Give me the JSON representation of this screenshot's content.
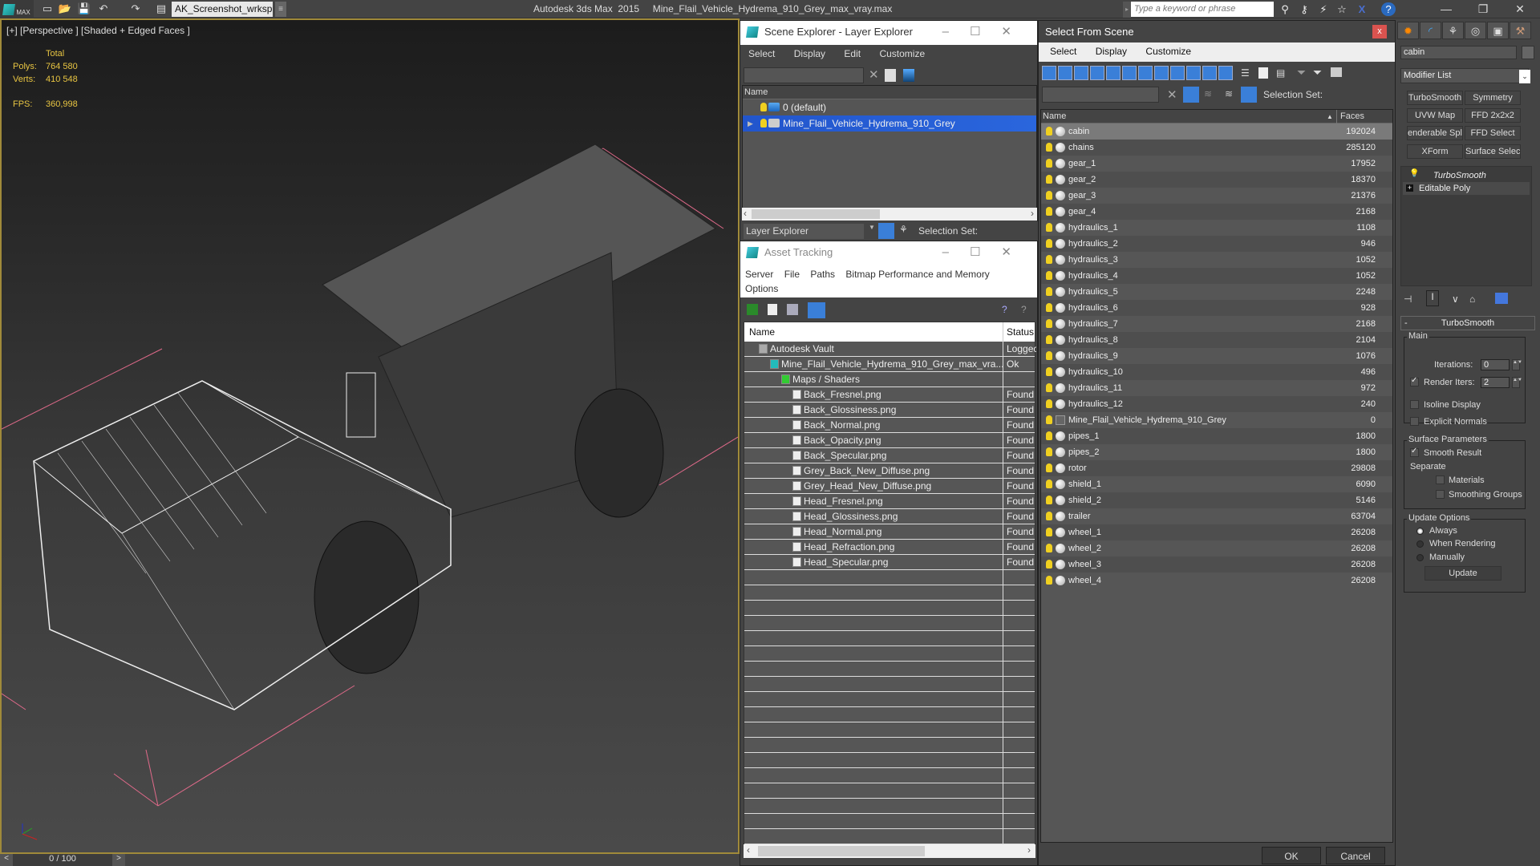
{
  "titlebar": {
    "workspace": "AK_Screenshot_wrksp",
    "app_title": "Autodesk 3ds Max  2015     Mine_Flail_Vehicle_Hydrema_910_Grey_max_vray.max",
    "search_placeholder": "Type a keyword or phrase",
    "logo_label": "MAX"
  },
  "viewport": {
    "label": "[+] [Perspective ] [Shaded + Edged Faces ]",
    "stats": {
      "header": "Total",
      "polys_label": "Polys:",
      "polys": "764 580",
      "verts_label": "Verts:",
      "verts": "410 548",
      "fps_label": "FPS:",
      "fps": "360,998"
    },
    "axis": {
      "x": "x",
      "y": "y",
      "z": "z"
    }
  },
  "timeline": {
    "range": "0 / 100",
    "prev": "<",
    "next": ">"
  },
  "scene_explorer": {
    "title": "Scene Explorer - Layer Explorer",
    "menu": [
      "Select",
      "Display",
      "Edit",
      "Customize"
    ],
    "column": "Name",
    "layers": [
      {
        "name": "0 (default)",
        "selected": false
      },
      {
        "name": "Mine_Flail_Vehicle_Hydrema_910_Grey",
        "selected": true
      }
    ],
    "explorer_type": "Layer Explorer",
    "selection_set_label": "Selection Set:"
  },
  "asset_tracking": {
    "title": "Asset Tracking",
    "menu": [
      "Server",
      "File",
      "Paths",
      "Bitmap Performance and Memory",
      "Options"
    ],
    "columns": [
      "Name",
      "Status"
    ],
    "rows": [
      {
        "name": "Autodesk Vault",
        "status": "Loggec",
        "level": 0,
        "icon": "vault-icon"
      },
      {
        "name": "Mine_Flail_Vehicle_Hydrema_910_Grey_max_vra...",
        "status": "Ok",
        "level": 1,
        "icon": "max-file-icon"
      },
      {
        "name": "Maps / Shaders",
        "status": "",
        "level": 2,
        "icon": "maps-icon"
      },
      {
        "name": "Back_Fresnel.png",
        "status": "Found",
        "level": 3,
        "icon": "bitmap-icon"
      },
      {
        "name": "Back_Glossiness.png",
        "status": "Found",
        "level": 3,
        "icon": "bitmap-icon"
      },
      {
        "name": "Back_Normal.png",
        "status": "Found",
        "level": 3,
        "icon": "bitmap-icon"
      },
      {
        "name": "Back_Opacity.png",
        "status": "Found",
        "level": 3,
        "icon": "bitmap-icon"
      },
      {
        "name": "Back_Specular.png",
        "status": "Found",
        "level": 3,
        "icon": "bitmap-icon"
      },
      {
        "name": "Grey_Back_New_Diffuse.png",
        "status": "Found",
        "level": 3,
        "icon": "bitmap-icon"
      },
      {
        "name": "Grey_Head_New_Diffuse.png",
        "status": "Found",
        "level": 3,
        "icon": "bitmap-icon"
      },
      {
        "name": "Head_Fresnel.png",
        "status": "Found",
        "level": 3,
        "icon": "bitmap-icon"
      },
      {
        "name": "Head_Glossiness.png",
        "status": "Found",
        "level": 3,
        "icon": "bitmap-icon"
      },
      {
        "name": "Head_Normal.png",
        "status": "Found",
        "level": 3,
        "icon": "bitmap-icon"
      },
      {
        "name": "Head_Refraction.png",
        "status": "Found",
        "level": 3,
        "icon": "bitmap-icon"
      },
      {
        "name": "Head_Specular.png",
        "status": "Found",
        "level": 3,
        "icon": "bitmap-icon"
      }
    ]
  },
  "select_from_scene": {
    "title": "Select From Scene",
    "close": "x",
    "menu": [
      "Select",
      "Display",
      "Customize"
    ],
    "selection_set_label": "Selection Set:",
    "columns": [
      "Name",
      "Faces"
    ],
    "objects": [
      {
        "name": "cabin",
        "faces": "192024",
        "selected": true
      },
      {
        "name": "chains",
        "faces": "285120"
      },
      {
        "name": "gear_1",
        "faces": "17952"
      },
      {
        "name": "gear_2",
        "faces": "18370"
      },
      {
        "name": "gear_3",
        "faces": "21376"
      },
      {
        "name": "gear_4",
        "faces": "2168"
      },
      {
        "name": "hydraulics_1",
        "faces": "1108"
      },
      {
        "name": "hydraulics_2",
        "faces": "946"
      },
      {
        "name": "hydraulics_3",
        "faces": "1052"
      },
      {
        "name": "hydraulics_4",
        "faces": "1052"
      },
      {
        "name": "hydraulics_5",
        "faces": "2248"
      },
      {
        "name": "hydraulics_6",
        "faces": "928"
      },
      {
        "name": "hydraulics_7",
        "faces": "2168"
      },
      {
        "name": "hydraulics_8",
        "faces": "2104"
      },
      {
        "name": "hydraulics_9",
        "faces": "1076"
      },
      {
        "name": "hydraulics_10",
        "faces": "496"
      },
      {
        "name": "hydraulics_11",
        "faces": "972"
      },
      {
        "name": "hydraulics_12",
        "faces": "240"
      },
      {
        "name": "Mine_Flail_Vehicle_Hydrema_910_Grey",
        "faces": "0",
        "group": true
      },
      {
        "name": "pipes_1",
        "faces": "1800"
      },
      {
        "name": "pipes_2",
        "faces": "1800"
      },
      {
        "name": "rotor",
        "faces": "29808"
      },
      {
        "name": "shield_1",
        "faces": "6090"
      },
      {
        "name": "shield_2",
        "faces": "5146"
      },
      {
        "name": "trailer",
        "faces": "63704"
      },
      {
        "name": "wheel_1",
        "faces": "26208"
      },
      {
        "name": "wheel_2",
        "faces": "26208"
      },
      {
        "name": "wheel_3",
        "faces": "26208"
      },
      {
        "name": "wheel_4",
        "faces": "26208"
      }
    ],
    "ok": "OK",
    "cancel": "Cancel"
  },
  "command_panel": {
    "object_name": "cabin",
    "modifier_list": "Modifier List",
    "modifier_buttons": [
      "TurboSmooth",
      "Symmetry",
      "UVW Map",
      "FFD 2x2x2",
      "enderable Splin",
      "FFD Select",
      "XForm",
      "Surface Select"
    ],
    "stack": [
      "TurboSmooth",
      "Editable Poly"
    ],
    "turbosmooth": {
      "title": "TurboSmooth",
      "collapse": "-",
      "main_label": "Main",
      "iterations_label": "Iterations:",
      "iterations": "0",
      "render_iters_label": "Render Iters:",
      "render_iters": "2",
      "render_iters_checked": true,
      "isoline_label": "Isoline Display",
      "isoline_checked": false,
      "explicit_normals_label": "Explicit Normals",
      "explicit_normals_checked": false,
      "surface_params_label": "Surface Parameters",
      "smooth_result_label": "Smooth Result",
      "smooth_result_checked": true,
      "separate_label": "Separate",
      "materials_label": "Materials",
      "smoothing_groups_label": "Smoothing Groups",
      "update_options_label": "Update Options",
      "update_options": [
        "Always",
        "When Rendering",
        "Manually"
      ],
      "update_selected": "Always",
      "update_button": "Update"
    }
  }
}
